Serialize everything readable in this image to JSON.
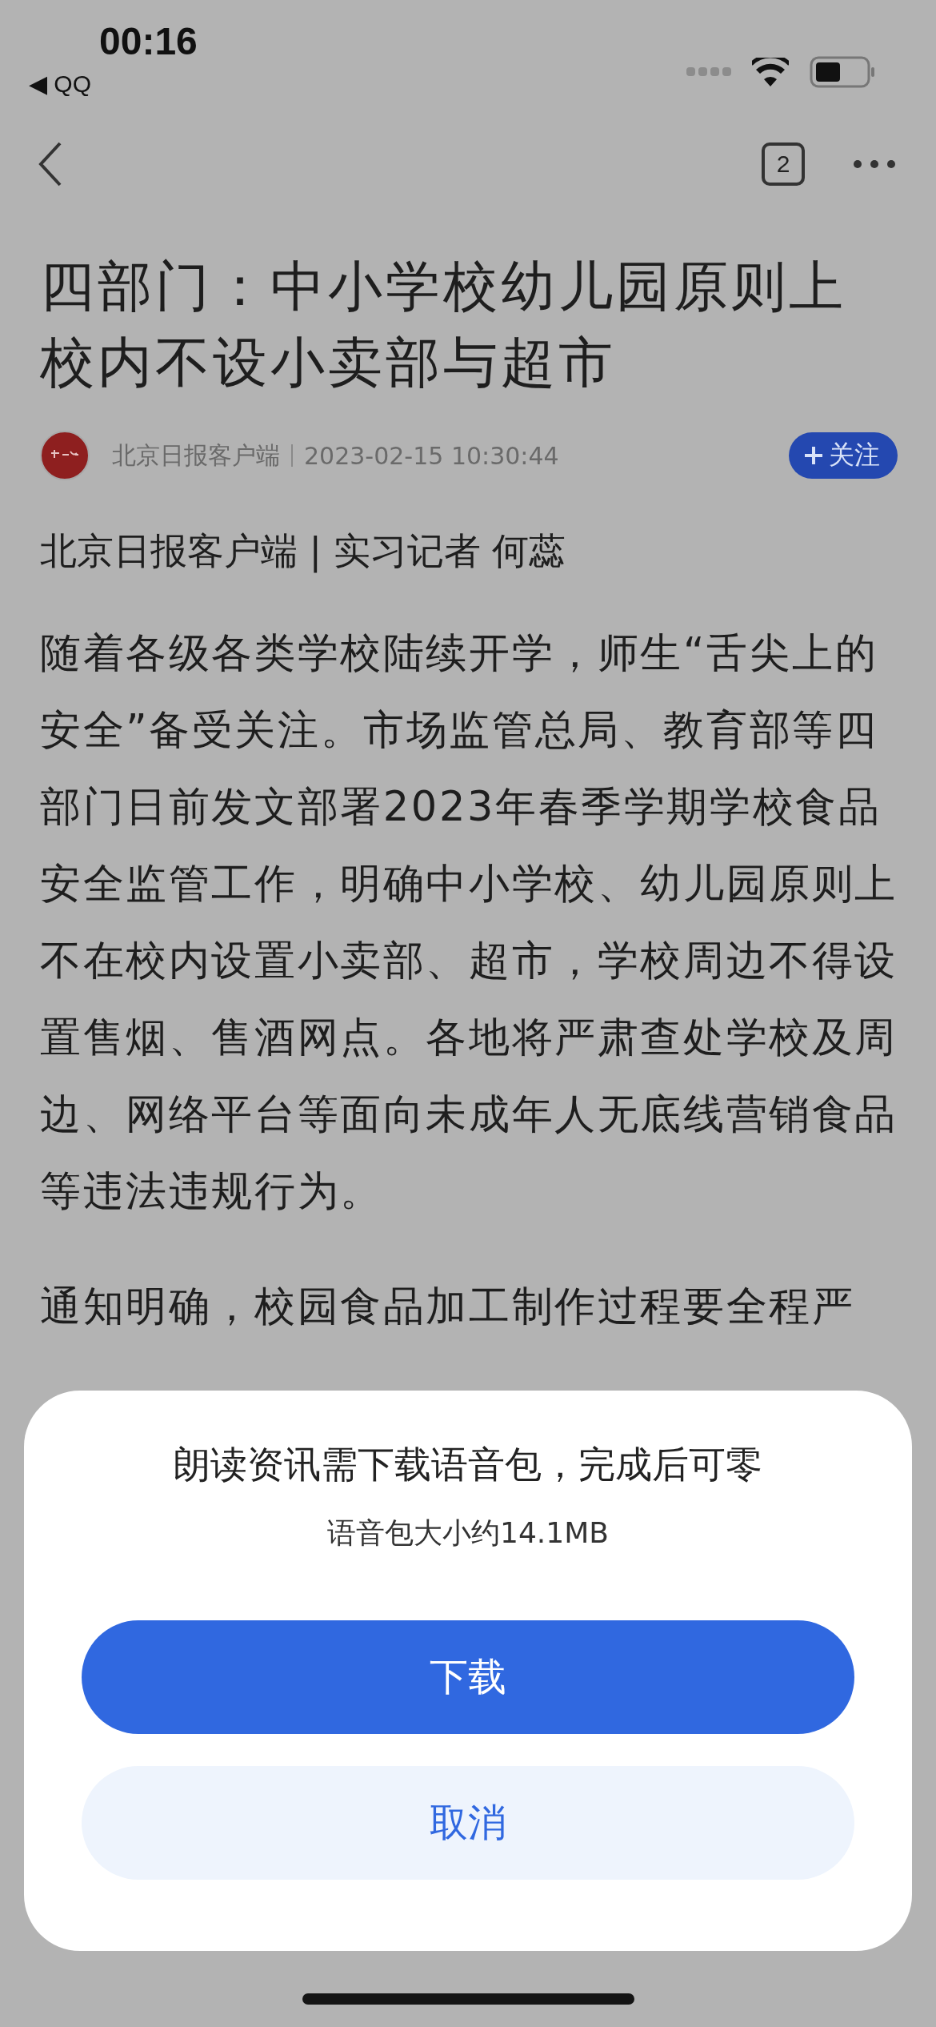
{
  "status_bar": {
    "time": "00:16",
    "back_app": "◀ QQ"
  },
  "nav": {
    "tab_count": "2"
  },
  "article": {
    "title": "四部门：中小学校幼儿园原则上校内不设小卖部与超市",
    "source": "北京日报客户端",
    "date": "2023-02-15 10:30:44",
    "follow": {
      "label": "关注",
      "followed": false
    },
    "byline": "北京日报客户端 | 实习记者 何蕊",
    "paragraphs": [
      "随着各级各类学校陆续开学，师生“舌尖上的安全”备受关注。市场监管总局、教育部等四部门日前发文部署2023年春季学期学校食品安全监管工作，明确中小学校、幼儿园原则上不在校内设置小卖部、超市，学校周边不得设置售烟、售酒网点。各地将严肃查处学校及周边、网络平台等面向未成年人无底线营销食品等违法违规行为。",
      "通知明确，校园食品加工制作过程要全程严"
    ]
  },
  "sheet": {
    "title": "朗读资讯需下载语音包，完成后可零",
    "subtitle": "语音包大小约14.1MB",
    "buttons": [
      {
        "label": "下载",
        "kind": "primary"
      },
      {
        "label": "取消",
        "kind": "secondary"
      }
    ]
  }
}
